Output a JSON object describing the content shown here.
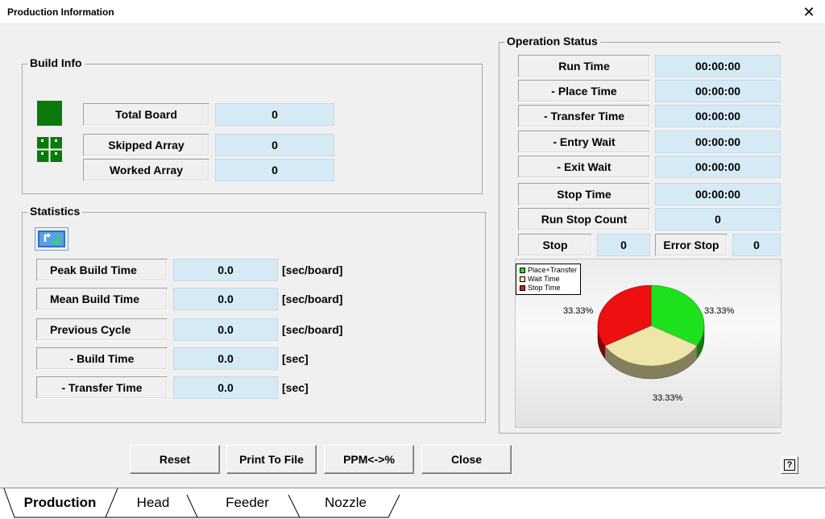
{
  "window": {
    "title": "Production Information",
    "close_glyph": "✕"
  },
  "build_info": {
    "title": "Build Info",
    "total_board": {
      "label": "Total Board",
      "value": "0"
    },
    "skipped_array": {
      "label": "Skipped Array",
      "value": "0"
    },
    "worked_array": {
      "label": "Worked Array",
      "value": "0"
    }
  },
  "statistics": {
    "title": "Statistics",
    "rows": [
      {
        "label": "Peak Build Time",
        "value": "0.0",
        "unit": "[sec/board]"
      },
      {
        "label": "Mean Build Time",
        "value": "0.0",
        "unit": "[sec/board]"
      },
      {
        "label": "Previous Cycle",
        "value": "0.0",
        "unit": "[sec/board]"
      },
      {
        "label": "- Build Time",
        "value": "0.0",
        "unit": "[sec]"
      },
      {
        "label": "- Transfer Time",
        "value": "0.0",
        "unit": "[sec]"
      }
    ]
  },
  "operation_status": {
    "title": "Operation Status",
    "rows": [
      {
        "label": "Run Time",
        "value": "00:00:00"
      },
      {
        "label": "- Place Time",
        "value": "00:00:00"
      },
      {
        "label": "- Transfer Time",
        "value": "00:00:00"
      },
      {
        "label": "- Entry Wait",
        "value": "00:00:00"
      },
      {
        "label": "- Exit Wait",
        "value": "00:00:00"
      },
      {
        "label": "Stop Time",
        "value": "00:00:00"
      },
      {
        "label": "Run Stop Count",
        "value": "0"
      }
    ],
    "stop": {
      "label": "Stop",
      "value": "0"
    },
    "error_stop": {
      "label": "Error Stop",
      "value": "0"
    }
  },
  "chart_data": {
    "type": "pie",
    "categories": [
      "Place+Transfer",
      "Wait Time",
      "Stop Time"
    ],
    "values": [
      33.33,
      33.33,
      33.33
    ],
    "labels": [
      "33.33%",
      "33.33%",
      "33.33%"
    ],
    "colors": [
      "#1ee11e",
      "#eee6a8",
      "#ee1010"
    ],
    "legend_position": "top-left"
  },
  "buttons": {
    "reset": "Reset",
    "print": "Print To File",
    "ppm": "PPM<->%",
    "close": "Close",
    "help": "?"
  },
  "tabs": [
    {
      "label": "Production",
      "active": true
    },
    {
      "label": "Head",
      "active": false
    },
    {
      "label": "Feeder",
      "active": false
    },
    {
      "label": "Nozzle",
      "active": false
    }
  ],
  "icons": {
    "board": "board-icon",
    "array": "array-icon",
    "refresh": "refresh-icon"
  },
  "colors": {
    "value_bg": "#d6eaf6",
    "board_green": "#0a7a0a"
  }
}
